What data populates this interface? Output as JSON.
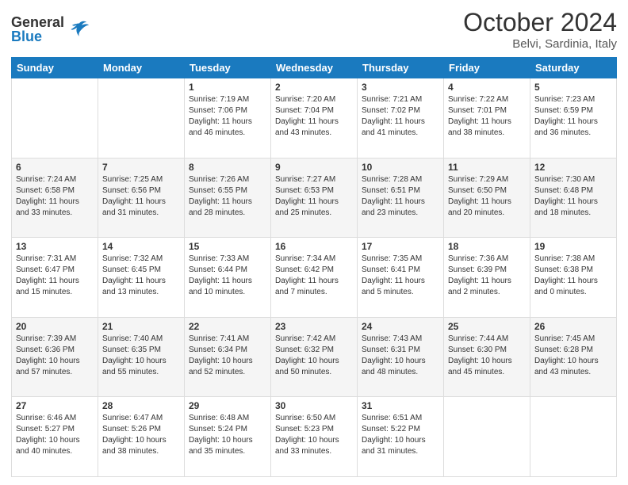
{
  "header": {
    "logo_line1": "General",
    "logo_line2": "Blue",
    "month": "October 2024",
    "location": "Belvi, Sardinia, Italy"
  },
  "weekdays": [
    "Sunday",
    "Monday",
    "Tuesday",
    "Wednesday",
    "Thursday",
    "Friday",
    "Saturday"
  ],
  "weeks": [
    [
      {
        "day": "",
        "info": ""
      },
      {
        "day": "",
        "info": ""
      },
      {
        "day": "1",
        "info": "Sunrise: 7:19 AM\nSunset: 7:06 PM\nDaylight: 11 hours\nand 46 minutes."
      },
      {
        "day": "2",
        "info": "Sunrise: 7:20 AM\nSunset: 7:04 PM\nDaylight: 11 hours\nand 43 minutes."
      },
      {
        "day": "3",
        "info": "Sunrise: 7:21 AM\nSunset: 7:02 PM\nDaylight: 11 hours\nand 41 minutes."
      },
      {
        "day": "4",
        "info": "Sunrise: 7:22 AM\nSunset: 7:01 PM\nDaylight: 11 hours\nand 38 minutes."
      },
      {
        "day": "5",
        "info": "Sunrise: 7:23 AM\nSunset: 6:59 PM\nDaylight: 11 hours\nand 36 minutes."
      }
    ],
    [
      {
        "day": "6",
        "info": "Sunrise: 7:24 AM\nSunset: 6:58 PM\nDaylight: 11 hours\nand 33 minutes."
      },
      {
        "day": "7",
        "info": "Sunrise: 7:25 AM\nSunset: 6:56 PM\nDaylight: 11 hours\nand 31 minutes."
      },
      {
        "day": "8",
        "info": "Sunrise: 7:26 AM\nSunset: 6:55 PM\nDaylight: 11 hours\nand 28 minutes."
      },
      {
        "day": "9",
        "info": "Sunrise: 7:27 AM\nSunset: 6:53 PM\nDaylight: 11 hours\nand 25 minutes."
      },
      {
        "day": "10",
        "info": "Sunrise: 7:28 AM\nSunset: 6:51 PM\nDaylight: 11 hours\nand 23 minutes."
      },
      {
        "day": "11",
        "info": "Sunrise: 7:29 AM\nSunset: 6:50 PM\nDaylight: 11 hours\nand 20 minutes."
      },
      {
        "day": "12",
        "info": "Sunrise: 7:30 AM\nSunset: 6:48 PM\nDaylight: 11 hours\nand 18 minutes."
      }
    ],
    [
      {
        "day": "13",
        "info": "Sunrise: 7:31 AM\nSunset: 6:47 PM\nDaylight: 11 hours\nand 15 minutes."
      },
      {
        "day": "14",
        "info": "Sunrise: 7:32 AM\nSunset: 6:45 PM\nDaylight: 11 hours\nand 13 minutes."
      },
      {
        "day": "15",
        "info": "Sunrise: 7:33 AM\nSunset: 6:44 PM\nDaylight: 11 hours\nand 10 minutes."
      },
      {
        "day": "16",
        "info": "Sunrise: 7:34 AM\nSunset: 6:42 PM\nDaylight: 11 hours\nand 7 minutes."
      },
      {
        "day": "17",
        "info": "Sunrise: 7:35 AM\nSunset: 6:41 PM\nDaylight: 11 hours\nand 5 minutes."
      },
      {
        "day": "18",
        "info": "Sunrise: 7:36 AM\nSunset: 6:39 PM\nDaylight: 11 hours\nand 2 minutes."
      },
      {
        "day": "19",
        "info": "Sunrise: 7:38 AM\nSunset: 6:38 PM\nDaylight: 11 hours\nand 0 minutes."
      }
    ],
    [
      {
        "day": "20",
        "info": "Sunrise: 7:39 AM\nSunset: 6:36 PM\nDaylight: 10 hours\nand 57 minutes."
      },
      {
        "day": "21",
        "info": "Sunrise: 7:40 AM\nSunset: 6:35 PM\nDaylight: 10 hours\nand 55 minutes."
      },
      {
        "day": "22",
        "info": "Sunrise: 7:41 AM\nSunset: 6:34 PM\nDaylight: 10 hours\nand 52 minutes."
      },
      {
        "day": "23",
        "info": "Sunrise: 7:42 AM\nSunset: 6:32 PM\nDaylight: 10 hours\nand 50 minutes."
      },
      {
        "day": "24",
        "info": "Sunrise: 7:43 AM\nSunset: 6:31 PM\nDaylight: 10 hours\nand 48 minutes."
      },
      {
        "day": "25",
        "info": "Sunrise: 7:44 AM\nSunset: 6:30 PM\nDaylight: 10 hours\nand 45 minutes."
      },
      {
        "day": "26",
        "info": "Sunrise: 7:45 AM\nSunset: 6:28 PM\nDaylight: 10 hours\nand 43 minutes."
      }
    ],
    [
      {
        "day": "27",
        "info": "Sunrise: 6:46 AM\nSunset: 5:27 PM\nDaylight: 10 hours\nand 40 minutes."
      },
      {
        "day": "28",
        "info": "Sunrise: 6:47 AM\nSunset: 5:26 PM\nDaylight: 10 hours\nand 38 minutes."
      },
      {
        "day": "29",
        "info": "Sunrise: 6:48 AM\nSunset: 5:24 PM\nDaylight: 10 hours\nand 35 minutes."
      },
      {
        "day": "30",
        "info": "Sunrise: 6:50 AM\nSunset: 5:23 PM\nDaylight: 10 hours\nand 33 minutes."
      },
      {
        "day": "31",
        "info": "Sunrise: 6:51 AM\nSunset: 5:22 PM\nDaylight: 10 hours\nand 31 minutes."
      },
      {
        "day": "",
        "info": ""
      },
      {
        "day": "",
        "info": ""
      }
    ]
  ]
}
